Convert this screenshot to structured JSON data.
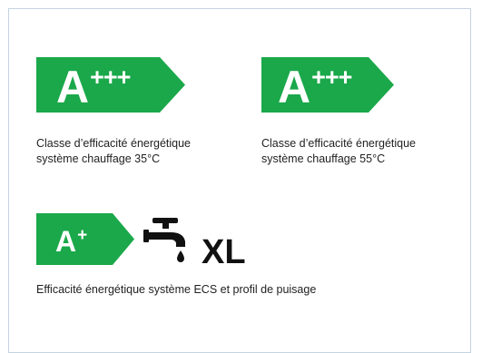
{
  "labels": [
    {
      "grade_letter": "A",
      "grade_suffix": "+++",
      "caption_line1": "Classe d’efficacité énergétique",
      "caption_line2": "système chauffage 35°C"
    },
    {
      "grade_letter": "A",
      "grade_suffix": "+++",
      "caption_line1": "Classe d’efficacité énergétique",
      "caption_line2": "système chauffage 55°C"
    }
  ],
  "ecs": {
    "grade_letter": "A",
    "grade_suffix": "+",
    "profile": "XL",
    "icon": "faucet-icon",
    "caption": "Efficacité énergétique système ECS et profil de puisage"
  },
  "colors": {
    "label_green": "#1aa84a"
  }
}
